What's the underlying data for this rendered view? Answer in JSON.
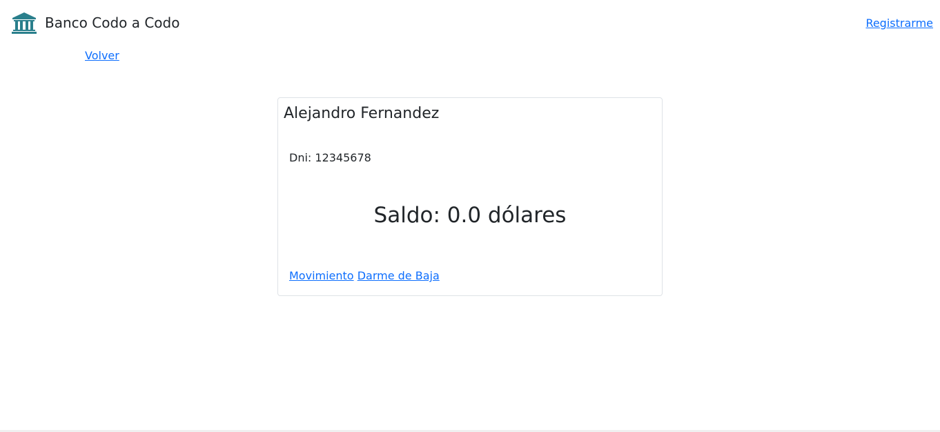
{
  "header": {
    "brand_name": "Banco Codo a Codo",
    "brand_icon": "bank-icon",
    "register_label": "Registrarme"
  },
  "nav": {
    "back_label": "Volver"
  },
  "account_card": {
    "holder_name": "Alejandro Fernandez",
    "dni_text": "Dni: 12345678",
    "balance_text": "Saldo: 0.0 dólares",
    "actions": {
      "movement_label": "Movimiento",
      "unsubscribe_label": "Darme de Baja"
    }
  },
  "colors": {
    "link": "#0d6efd",
    "icon": "#2a7f8c",
    "text": "#212529",
    "card_border": "#dee2e6"
  }
}
